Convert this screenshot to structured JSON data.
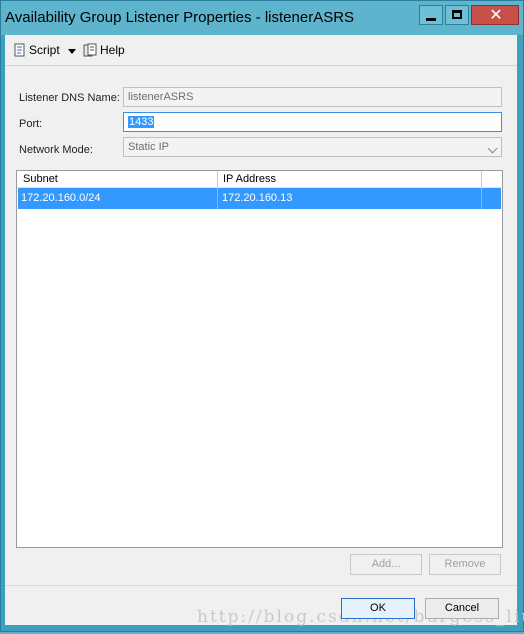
{
  "window": {
    "title": "Availability Group Listener Properties - listenerASRS"
  },
  "toolbar": {
    "script_label": "Script",
    "script_icon": "script-icon",
    "help_label": "Help",
    "help_icon": "help-icon"
  },
  "form": {
    "dns_label": "Listener DNS Name:",
    "dns_value": "listenerASRS",
    "port_label": "Port:",
    "port_value": "1433",
    "mode_label": "Network Mode:",
    "mode_value": "Static IP"
  },
  "grid": {
    "columns": [
      "Subnet",
      "IP Address"
    ],
    "rows": [
      {
        "subnet": "172.20.160.0/24",
        "ip": "172.20.160.13"
      }
    ]
  },
  "buttons": {
    "add": "Add...",
    "remove": "Remove",
    "ok": "OK",
    "cancel": "Cancel"
  },
  "watermark": "http://blog.csdn.net/burgess_liu"
}
